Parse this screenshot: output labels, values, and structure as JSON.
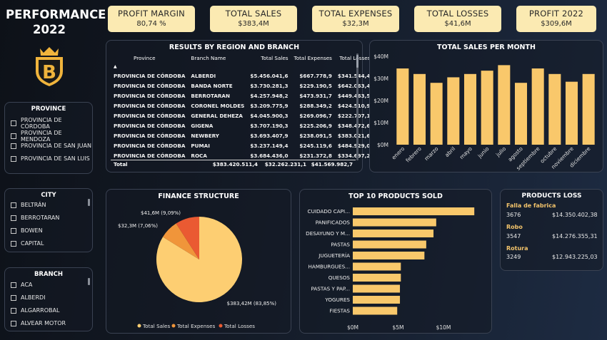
{
  "header": {
    "title_line1": "PERFORMANCE",
    "title_line2": "2022"
  },
  "logo": {
    "letter": "B",
    "colors": {
      "gold": "#f0b43c",
      "dark": "#1a1a1a"
    }
  },
  "kpis": [
    {
      "label": "PROFIT MARGIN",
      "value": "80,74 %"
    },
    {
      "label": "TOTAL SALES",
      "value": "$383,4M"
    },
    {
      "label": "TOTAL EXPENSES",
      "value": "$32,3M"
    },
    {
      "label": "TOTAL LOSSES",
      "value": "$41,6M"
    },
    {
      "label": "PROFIT 2022",
      "value": "$309,6M"
    }
  ],
  "slicers": {
    "province": {
      "title": "PROVINCE",
      "items": [
        "PROVINCIA DE CÓRDOBA",
        "PROVINCIA DE MENDOZA",
        "PROVINCIA DE SAN JUAN",
        "PROVINCIA DE SAN LUIS"
      ]
    },
    "city": {
      "title": "CITY",
      "items": [
        "BELTRÁN",
        "BERROTARAN",
        "BOWEN",
        "CAPITAL"
      ]
    },
    "branch": {
      "title": "BRANCH",
      "items": [
        "ACA",
        "ALBERDI",
        "ALGARROBAL",
        "ALVEAR MOTOR"
      ]
    }
  },
  "results_table": {
    "title": "RESULTS BY REGION AND BRANCH",
    "sort_indicator": "▲",
    "columns": [
      "Province",
      "Branch Name",
      "Total Sales",
      "Total Expenses",
      "Total Losses"
    ],
    "rows": [
      [
        "PROVINCIA DE CÓRDOBA",
        "ALBERDI",
        "$5.456.041,6",
        "$667.778,9",
        "$341.544,4"
      ],
      [
        "PROVINCIA DE CÓRDOBA",
        "BANDA NORTE",
        "$3.730.281,3",
        "$229.190,5",
        "$642.063,4"
      ],
      [
        "PROVINCIA DE CÓRDOBA",
        "BERROTARAN",
        "$4.257.948,2",
        "$473.931,7",
        "$449.463,5"
      ],
      [
        "PROVINCIA DE CÓRDOBA",
        "CORONEL MOLDES",
        "$3.209.775,9",
        "$288.349,2",
        "$424.510,9"
      ],
      [
        "PROVINCIA DE CÓRDOBA",
        "GENERAL DEHEZA",
        "$4.045.900,3",
        "$269.096,7",
        "$222.707,1"
      ],
      [
        "PROVINCIA DE CÓRDOBA",
        "GIGENA",
        "$3.707.190,3",
        "$225.206,9",
        "$348.472,6"
      ],
      [
        "PROVINCIA DE CÓRDOBA",
        "NEWBERY",
        "$3.693.407,9",
        "$238.091,5",
        "$383.021,6"
      ],
      [
        "PROVINCIA DE CÓRDOBA",
        "PUMAI",
        "$3.237.149,4",
        "$245.119,6",
        "$484.929,0"
      ],
      [
        "PROVINCIA DE CÓRDOBA",
        "ROCA",
        "$3.684.436,0",
        "$231.372,8",
        "$334.697,2"
      ]
    ],
    "total": [
      "Total",
      "",
      "$383.420.511,4",
      "$32.262.231,1",
      "$41.569.982,7"
    ]
  },
  "sales_chart_title": "TOTAL SALES PER MONTH",
  "finance_title": "FINANCE STRUCTURE",
  "top10_title": "TOP 10 PRODUCTS SOLD",
  "products_loss": {
    "title": "PRODUCTS LOSS",
    "items": [
      {
        "name": "Falla de fabrica",
        "qty": "3676",
        "value": "$14.350.402,38"
      },
      {
        "name": "Robo",
        "qty": "3547",
        "value": "$14.276.355,31"
      },
      {
        "name": "Rotura",
        "qty": "3249",
        "value": "$12.943.225,03"
      }
    ]
  },
  "chart_data": [
    {
      "type": "bar",
      "title": "TOTAL SALES PER MONTH",
      "categories": [
        "enero",
        "febrero",
        "marzo",
        "abril",
        "mayo",
        "junio",
        "julio",
        "agosto",
        "septiembre",
        "octubre",
        "noviembre",
        "diciembre"
      ],
      "values": [
        34.5,
        32.0,
        28.0,
        30.5,
        32.0,
        33.5,
        36.0,
        28.0,
        34.5,
        32.0,
        28.5,
        32.0
      ],
      "y_tick_labels": [
        "$0M",
        "$10M",
        "$20M",
        "$30M",
        "$40M"
      ],
      "ylim": [
        0,
        40
      ],
      "colors": {
        "bar": "#f9c86b"
      }
    },
    {
      "type": "pie",
      "title": "FINANCE STRUCTURE",
      "slices": [
        {
          "name": "Total Sales",
          "value": 383.42,
          "label": "$383,42M (83,85%)",
          "color": "#fdce72"
        },
        {
          "name": "Total Expenses",
          "value": 32.3,
          "label": "$32,3M (7,06%)",
          "color": "#f0953a"
        },
        {
          "name": "Total Losses",
          "value": 41.6,
          "label": "$41,6M (9,09%)",
          "color": "#ea5a32"
        }
      ],
      "legend_placement": "bottom"
    },
    {
      "type": "bar",
      "orientation": "horizontal",
      "title": "TOP 10 PRODUCTS SOLD",
      "categories": [
        "CUIDADO CAPI...",
        "PANIFICADOS",
        "DESAYUNO Y M...",
        "PASTAS",
        "JUGUETERÍA",
        "HAMBURGUES...",
        "QUESOS",
        "PASTAS Y PAP...",
        "YOGURES",
        "FIESTAS"
      ],
      "values": [
        13.4,
        9.2,
        8.9,
        8.1,
        7.9,
        5.3,
        5.3,
        5.2,
        5.2,
        4.9
      ],
      "x_tick_labels": [
        "$0M",
        "$5M",
        "$10M"
      ],
      "xlim": [
        0,
        15
      ],
      "colors": {
        "bar": "#f9c86b"
      }
    }
  ]
}
